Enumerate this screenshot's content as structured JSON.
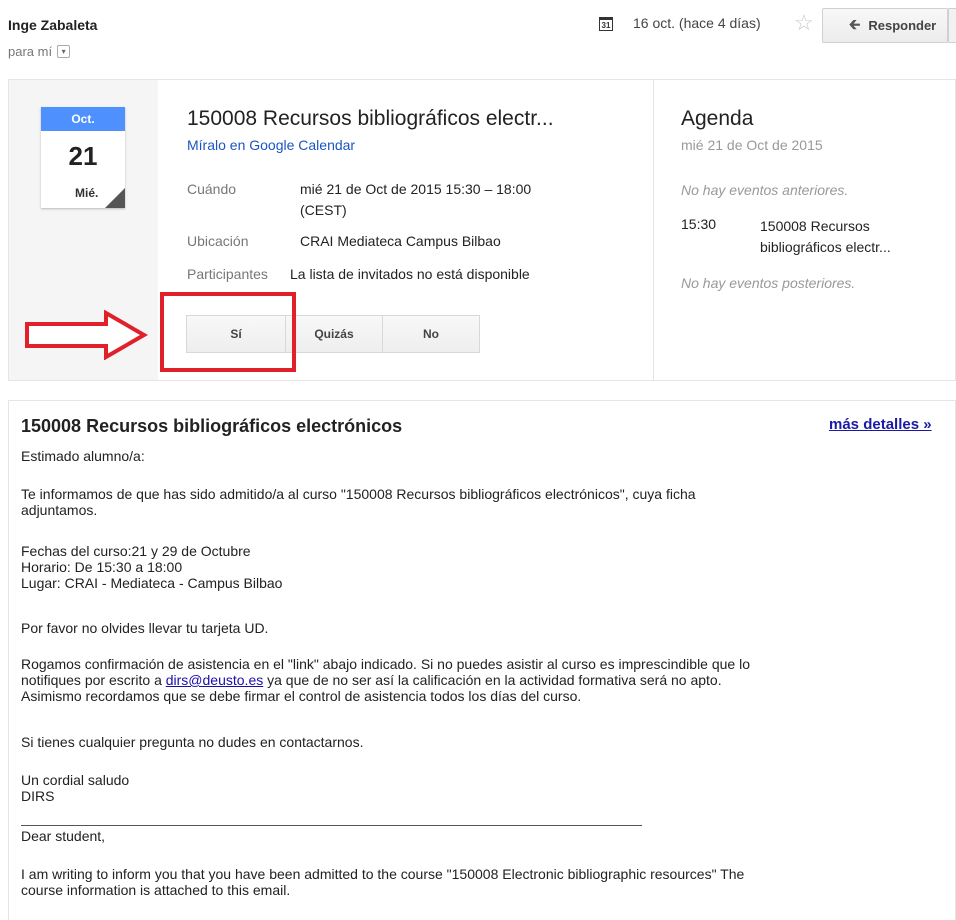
{
  "header": {
    "sender": "Inge Zabaleta",
    "to": "para mí",
    "calendar_icon_text": "31",
    "date": "16 oct. (hace 4 días)",
    "reply_label": "Responder"
  },
  "invite": {
    "calendar_month": "Oct.",
    "calendar_day": "21",
    "calendar_weekday": "Mié.",
    "title": "150008 Recursos bibliográficos electr...",
    "calendar_link": "Míralo en Google Calendar",
    "when_label": "Cuándo",
    "when_line1": "mié 21 de Oct de 2015 15:30 – 18:00",
    "when_line2": "(CEST)",
    "where_label": "Ubicación",
    "where_value": "CRAI Mediateca Campus Bilbao",
    "attendees_label": "Participantes",
    "attendees_value": "La lista de invitados no está disponible",
    "rsvp": {
      "yes": "Sí",
      "maybe": "Quizás",
      "no": "No"
    }
  },
  "agenda": {
    "title": "Agenda",
    "date": "mié 21 de Oct de 2015",
    "no_prior": "No hay eventos anteriores.",
    "event_time": "15:30",
    "event_line1": "150008 Recursos",
    "event_line2": "bibliográficos electr...",
    "no_after": "No hay eventos posteriores."
  },
  "body": {
    "title": "150008 Recursos bibliográficos electrónicos",
    "more_details": "más detalles »",
    "greeting": "Estimado alumno/a:",
    "p1_line1": "Te informamos de que has sido admitido/a al curso \"150008 Recursos bibliográficos electrónicos\", cuya ficha",
    "p1_line2": "adjuntamos.",
    "dates": "Fechas del curso:21 y 29 de Octubre",
    "schedule": "Horario: De 15:30 a 18:00",
    "place": "Lugar: CRAI - Mediateca - Campus Bilbao",
    "reminder": "Por favor no olvides llevar tu tarjeta UD.",
    "p2_line1": "Rogamos confirmación de asistencia en el  \"link\" abajo indicado. Si no puedes asistir al curso es imprescindible que lo",
    "p2_line2_pre": "notifiques por escrito a ",
    "p2_email": "dirs@deusto.es",
    "p2_line2_post": " ya que de no ser así la calificación en la actividad formativa será no apto.",
    "p2_line3": "Asimismo recordamos que se debe firmar el control de asistencia todos los días del curso.",
    "questions": "Si tienes cualquier pregunta no dudes en contactarnos.",
    "closing": "Un cordial saludo",
    "signature": "DIRS",
    "en_greeting": "Dear student,",
    "en_line1": "I am writing to inform you that you have been admitted to the course  \"150008 Electronic bibliographic resources\" The",
    "en_line2": "course information is attached to this email."
  },
  "colors": {
    "highlight": "#e0202a",
    "calendar_blue": "#4d90fe",
    "link_blue": "#1a55c2"
  }
}
